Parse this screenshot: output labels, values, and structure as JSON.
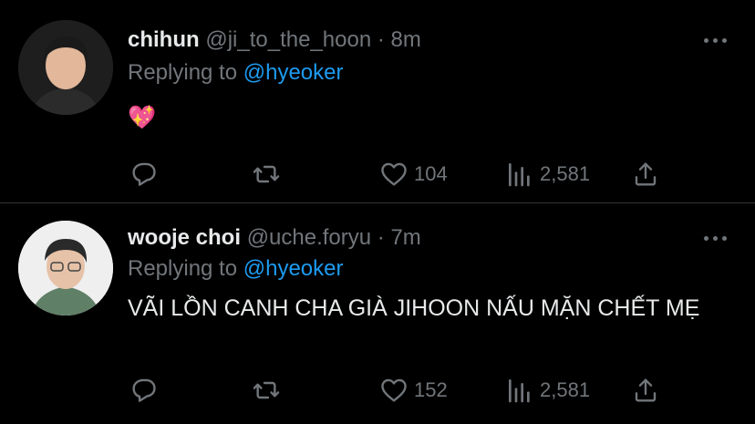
{
  "tweets": [
    {
      "name": "chihun",
      "handle": "@ji_to_the_hoon · 8m",
      "replying_prefix": "Replying to ",
      "replying_to": "@hyeoker",
      "text": "💖",
      "likes": "104",
      "views": "2,581"
    },
    {
      "name": "wooje choi",
      "handle": "@uche.foryu · 7m",
      "replying_prefix": "Replying to ",
      "replying_to": "@hyeoker",
      "text": "VÃI LỒN CANH CHA GIÀ JIHOON NẤU MẶN CHẾT MẸ",
      "likes": "152",
      "views": "2,581"
    }
  ],
  "icons": {
    "reply": "reply-icon",
    "retweet": "retweet-icon",
    "like": "heart-icon",
    "views": "views-icon",
    "share": "share-icon",
    "more": "more-icon"
  },
  "colors": {
    "background": "#000000",
    "text": "#e7e9ea",
    "secondary": "#71767b",
    "link": "#1d9bf0",
    "divider": "#2f3336"
  }
}
